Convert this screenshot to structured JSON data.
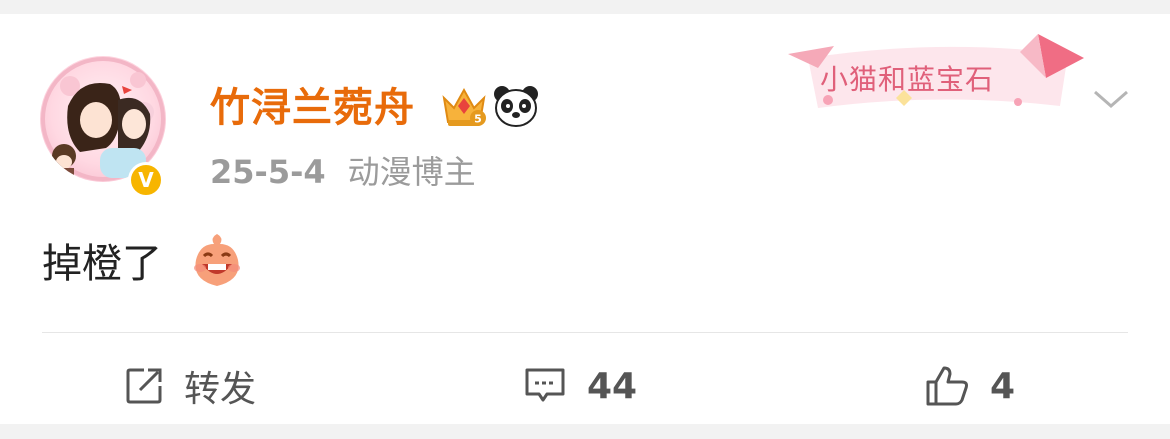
{
  "post": {
    "username": "竹浔兰菀舟",
    "date": "25-5-4",
    "tag": "动漫博主",
    "content": "掉橙了",
    "sticker_text": "小猫和蓝宝石",
    "badges": [
      "crown-vip-icon",
      "panda-icon"
    ],
    "crown_level": "5",
    "verified_badge": "V",
    "content_emoji": "laughing-emoji-icon"
  },
  "actions": {
    "repost_label": "转发",
    "comment_count": "44",
    "like_count": "4"
  },
  "colors": {
    "username": "#e86b0a",
    "meta": "#9b9b9b",
    "verified": "#f7b500",
    "text": "#222222"
  }
}
